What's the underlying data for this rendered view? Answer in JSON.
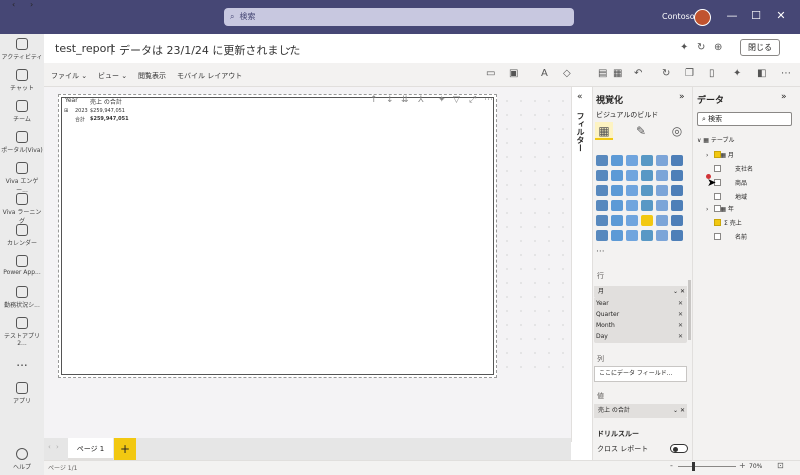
{
  "titlebar": {
    "back": "‹",
    "forward": "›",
    "search_placeholder": "検索",
    "tenant": "Contoso",
    "minimize": "—",
    "maximize": "☐",
    "close": "✕"
  },
  "rail": {
    "items": [
      {
        "label": "アクティビティ"
      },
      {
        "label": "チャット"
      },
      {
        "label": "チーム"
      },
      {
        "label": "ポータル(Viva)"
      },
      {
        "label": "Viva エンゲー..."
      },
      {
        "label": "Viva ラーニング"
      },
      {
        "label": "カレンダー"
      },
      {
        "label": "Power App..."
      },
      {
        "label": "勤務状況シ..."
      },
      {
        "label": "テストアプリ2..."
      },
      {
        "label": "アプリ"
      },
      {
        "label": "ヘルプ"
      }
    ],
    "more": "..."
  },
  "report": {
    "title": "test_report",
    "separator": "|",
    "updated": "データは 23/1/24 に更新されました",
    "chevron": "⌄",
    "close_button": "閉じる"
  },
  "menu": {
    "file": "ファイル ⌄",
    "view": "ビュー ⌄",
    "reading": "閲覧表示",
    "mobile": "モバイル レイアウト"
  },
  "matrix": {
    "header_year": "Year",
    "header_value": "売上 の合計",
    "rows": [
      {
        "expand": "⊞",
        "label": "2023",
        "value": "$259,947,051"
      },
      {
        "expand": "",
        "label": "合計",
        "value": "$259,947,051"
      }
    ]
  },
  "pages": {
    "tab": "ページ 1",
    "add": "+",
    "status": "ページ 1/1",
    "zoom": "70%"
  },
  "filters": {
    "label": "フィルター"
  },
  "viz": {
    "title": "視覚化",
    "build_label": "ビジュアルのビルド",
    "more": "···",
    "rows_label": "行",
    "rows_header": "月",
    "rows_fields": [
      "Year",
      "Quarter",
      "Month",
      "Day"
    ],
    "columns_label": "列",
    "columns_placeholder": "ここにデータ フィールド...",
    "values_label": "値",
    "values_field": "売上 の合計",
    "drill_label": "ドリルスルー",
    "cross_report": "クロス レポート"
  },
  "data_pane": {
    "title": "データ",
    "search_placeholder": "検索",
    "table": "テーブル",
    "fields": [
      {
        "name": "月",
        "checked": true
      },
      {
        "name": "支社名",
        "checked": false
      },
      {
        "name": "商品",
        "checked": false
      },
      {
        "name": "地域",
        "checked": false
      },
      {
        "name": "年",
        "checked": false
      },
      {
        "name": "売上",
        "checked": true
      },
      {
        "name": "名前",
        "checked": false
      }
    ]
  },
  "colors": {
    "titlebar": "#464775",
    "accent": "#f2c811"
  }
}
